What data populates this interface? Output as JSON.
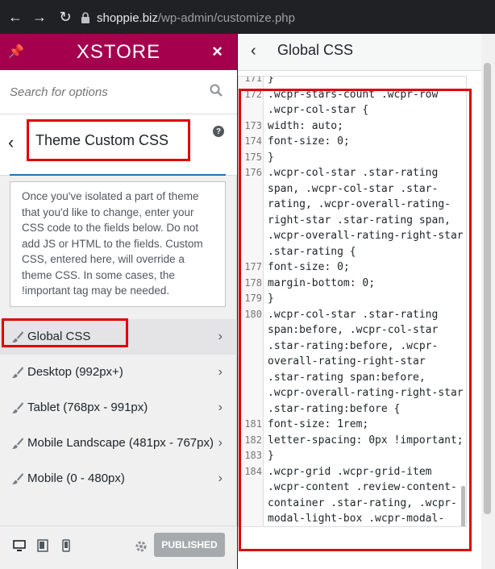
{
  "browser": {
    "url_host": "shoppie.biz",
    "url_path": "/wp-admin/customize.php"
  },
  "brand": {
    "name": "XSTORE"
  },
  "search": {
    "placeholder": "Search for options"
  },
  "section": {
    "title": "Theme Custom CSS",
    "help_symbol": "?",
    "description": "Once you've isolated a part of theme that you'd like to change, enter your CSS code to the fields below. Do not add JS or HTML to the fields. Custom CSS, entered here, will override a theme CSS. In some cases, the !important tag may be needed."
  },
  "menu": [
    {
      "label": "Global CSS",
      "active": true
    },
    {
      "label": "Desktop (992px+)",
      "active": false
    },
    {
      "label": "Tablet (768px - 991px)",
      "active": false
    },
    {
      "label": "Mobile Landscape (481px - 767px)",
      "active": false
    },
    {
      "label": "Mobile (0 - 480px)",
      "active": false
    }
  ],
  "footer": {
    "publish_label": "PUBLISHED"
  },
  "right_panel": {
    "title": "Global CSS"
  },
  "code": [
    {
      "n": "171",
      "t": "}"
    },
    {
      "n": "172",
      "t": ".wcpr-stars-count .wcpr-row"
    },
    {
      "n": "",
      "t": ".wcpr-col-star {"
    },
    {
      "n": "173",
      "t": "width: auto;"
    },
    {
      "n": "174",
      "t": "font-size: 0;"
    },
    {
      "n": "175",
      "t": "}"
    },
    {
      "n": "176",
      "t": ".wcpr-col-star .star-rating"
    },
    {
      "n": "",
      "t": "span, .wcpr-col-star .star-"
    },
    {
      "n": "",
      "t": "rating, .wcpr-overall-rating-"
    },
    {
      "n": "",
      "t": "right-star .star-rating span,"
    },
    {
      "n": "",
      "t": ".wcpr-overall-rating-right-star"
    },
    {
      "n": "",
      "t": ".star-rating {"
    },
    {
      "n": "177",
      "t": "font-size: 0;"
    },
    {
      "n": "178",
      "t": "margin-bottom: 0;"
    },
    {
      "n": "179",
      "t": "}"
    },
    {
      "n": "180",
      "t": ".wcpr-col-star .star-rating"
    },
    {
      "n": "",
      "t": "span:before, .wcpr-col-star"
    },
    {
      "n": "",
      "t": ".star-rating:before, .wcpr-"
    },
    {
      "n": "",
      "t": "overall-rating-right-star"
    },
    {
      "n": "",
      "t": ".star-rating span:before,"
    },
    {
      "n": "",
      "t": ".wcpr-overall-rating-right-star"
    },
    {
      "n": "",
      "t": ".star-rating:before {"
    },
    {
      "n": "181",
      "t": "font-size: 1rem;"
    },
    {
      "n": "182",
      "t": "letter-spacing: 0px !important;"
    },
    {
      "n": "183",
      "t": "}"
    },
    {
      "n": "184",
      "t": ".wcpr-grid .wcpr-grid-item"
    },
    {
      "n": "",
      "t": ".wcpr-content .review-content-"
    },
    {
      "n": "",
      "t": "container .star-rating, .wcpr-"
    },
    {
      "n": "",
      "t": "modal-light-box .wcpr-modal-"
    }
  ]
}
